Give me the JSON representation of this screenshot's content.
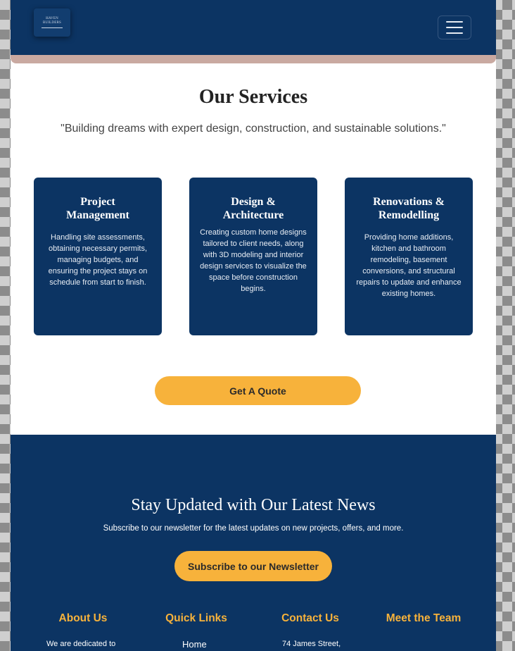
{
  "navbar": {
    "logo_line1": "HAVEN",
    "logo_line2": "BUILDERS",
    "menu_icon": "hamburger-menu-icon"
  },
  "services": {
    "title": "Our Services",
    "subtitle": "\"Building dreams with expert design, construction, and sustainable solutions.\"",
    "cards": [
      {
        "title": "Project Management",
        "text": "Handling site assessments, obtaining necessary permits, managing budgets, and ensuring the project stays on schedule from start to finish."
      },
      {
        "title": "Design & Architecture",
        "text": "Creating custom home designs tailored to client needs, along with 3D modeling and interior design services to visualize the space before construction begins."
      },
      {
        "title": "Renovations & Remodelling",
        "text": "Providing home additions, kitchen and bathroom remodeling, basement conversions, and structural repairs to update and enhance existing homes."
      }
    ],
    "cta_label": "Get A Quote"
  },
  "newsletter": {
    "title": "Stay Updated with Our Latest News",
    "subtitle": "Subscribe to our newsletter for the latest updates on new projects, offers, and more.",
    "button_label": "Subscribe to our Newsletter"
  },
  "footer": {
    "columns": [
      {
        "heading": "About Us",
        "text": "We are dedicated to"
      },
      {
        "heading": "Quick Links",
        "text": "Home"
      },
      {
        "heading": "Contact Us",
        "text": "74 James Street,"
      },
      {
        "heading": "Meet the Team",
        "text": ""
      }
    ]
  },
  "colors": {
    "navy": "#0c3463",
    "accent": "#f7b23b",
    "white": "#ffffff"
  }
}
